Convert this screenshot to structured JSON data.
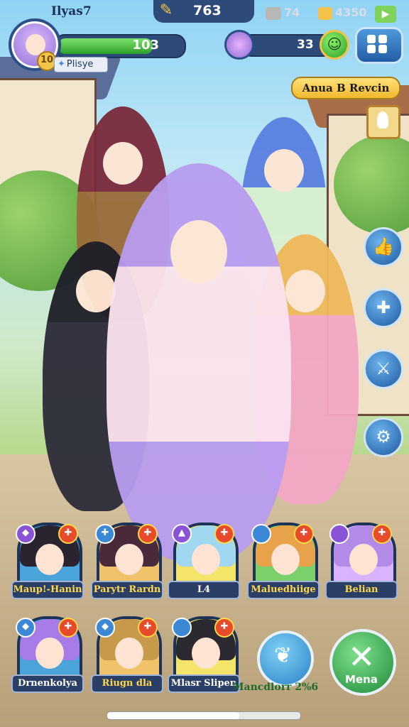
{
  "hud": {
    "player_name": "Ilyas7",
    "gold": "763",
    "stat_a": "74",
    "stat_b": "4350",
    "hp_value": "103",
    "hp_percent": 0.78,
    "player_tag": "Plisye",
    "level": "10",
    "friend_value": "33",
    "colors": {
      "panel": "#2d4a78",
      "accent": "#f4c44a",
      "hp": "#2e9e2a"
    }
  },
  "event": {
    "banner": "Anua B Revcin"
  },
  "side_buttons": [
    {
      "icon": "thumbs-up-icon",
      "glyph": "👍"
    },
    {
      "icon": "puzzle-icon",
      "glyph": "✚"
    },
    {
      "icon": "crossed-swords-icon",
      "glyph": "⚔"
    },
    {
      "icon": "gear-icon",
      "glyph": "⚙"
    }
  ],
  "roster_row1": [
    {
      "name": "Maup!-Hanin",
      "left_badge": "◆",
      "left_color": "#8a53d6",
      "hair": "#2a2430",
      "bg": "#4aa3d9"
    },
    {
      "name": "Parytr Rardn",
      "left_badge": "✚",
      "left_color": "#3b88d6",
      "hair": "#4a2a3a",
      "bg": "#f0c26a"
    },
    {
      "name": "L4",
      "left_badge": "▲",
      "left_color": "#8a53d6",
      "hair": "#9fd8f0",
      "bg": "#f4e46a"
    },
    {
      "name": "Maluedhiige",
      "left_badge": "",
      "left_color": "#3b88d6",
      "hair": "#e8a24a",
      "bg": "#7ad06a"
    },
    {
      "name": "Belian",
      "left_badge": "",
      "left_color": "#8a53d6",
      "hair": "#b48ae8",
      "bg": "#d9b3ff"
    }
  ],
  "roster_row2": [
    {
      "name": "Drnenkolya",
      "left_badge": "◆",
      "left_color": "#3b88d6",
      "hair": "#a77be8",
      "bg": "#4aa3d9"
    },
    {
      "name": "Riugn dla",
      "left_badge": "◆",
      "left_color": "#3b88d6",
      "hair": "#c69a4a",
      "bg": "#f0c26a"
    },
    {
      "name": "Mlasr Slipen",
      "left_badge": "",
      "left_color": "#3b88d6",
      "hair": "#2a2a30",
      "bg": "#f4e46a"
    }
  ],
  "actions": {
    "pet_label": "Mancdlorr 2%6",
    "menu_label": "Mena"
  }
}
